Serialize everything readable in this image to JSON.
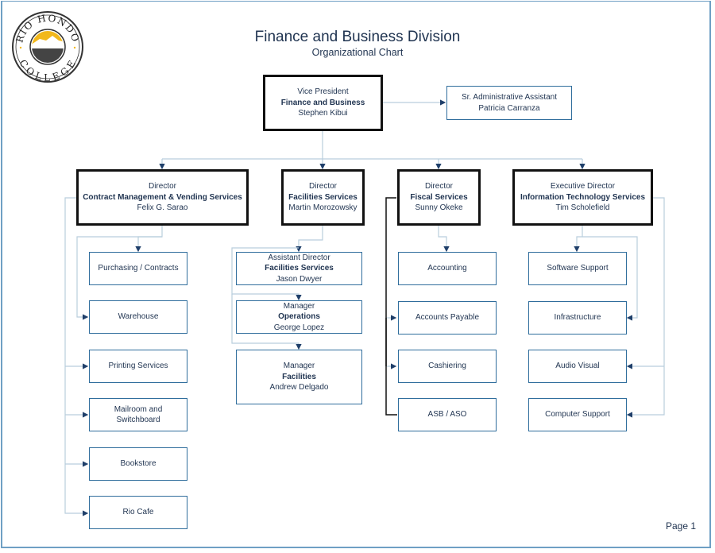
{
  "header": {
    "logo": {
      "top_text": "RÍO HONDO",
      "bottom_text": "COLLEGE",
      "icon": "college-seal-icon"
    },
    "title": "Finance and Business Division",
    "subtitle": "Organizational Chart"
  },
  "vp": {
    "role": "Vice President",
    "dept": "Finance and Business",
    "name": "Stephen Kibui"
  },
  "assistant": {
    "role": "Sr. Administrative Assistant",
    "name": "Patricia Carranza"
  },
  "directors": [
    {
      "role": "Director",
      "dept": "Contract Management & Vending Services",
      "name": "Felix G. Sarao",
      "units": [
        "Purchasing / Contracts",
        "Warehouse",
        "Printing Services",
        "Mailroom and Switchboard",
        "Bookstore",
        "Rio Cafe"
      ]
    },
    {
      "role": "Director",
      "dept": "Facilities Services",
      "name": "Martin Morozowsky",
      "units": [
        {
          "role": "Assistant  Director",
          "dept": "Facilities Services",
          "name": "Jason Dwyer"
        },
        {
          "role": "Manager",
          "dept": "Operations",
          "name": "George Lopez"
        },
        {
          "role": "Manager",
          "dept": "Facilities",
          "name": "Andrew Delgado"
        }
      ]
    },
    {
      "role": "Director",
      "dept": "Fiscal Services",
      "name": "Sunny Okeke",
      "units": [
        "Accounting",
        "Accounts Payable",
        "Cashiering",
        "ASB / ASO"
      ]
    },
    {
      "role": "Executive Director",
      "dept": "Information Technology Services",
      "name": "Tim Scholefield",
      "units": [
        "Software Support",
        "Infrastructure",
        "Audio Visual",
        "Computer Support"
      ]
    }
  ],
  "footer": {
    "page": "Page 1"
  },
  "colors": {
    "connector": "#b9cedd",
    "arrow": "#1f3f6a",
    "unit_border": "#2f6d9c",
    "lead_border": "#111111",
    "frame": "#6fa0c4"
  }
}
